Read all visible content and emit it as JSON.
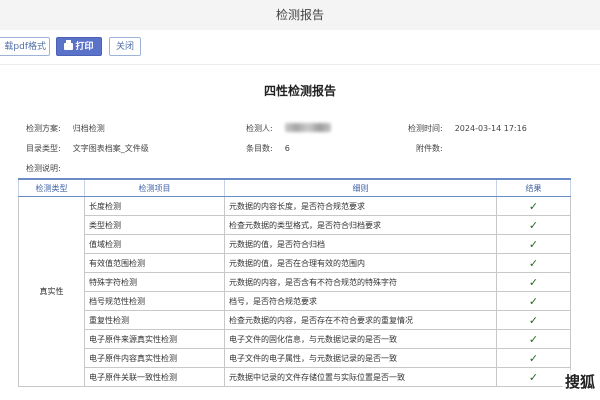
{
  "window": {
    "title": "检测报告"
  },
  "toolbar": {
    "export_label": "载pdf格式",
    "print_label": "打印",
    "close_label": "关闭"
  },
  "report": {
    "title": "四性检测报告",
    "meta": {
      "scheme_label": "检测方案:",
      "scheme_value": "归档检测",
      "inspector_label": "检测人:",
      "time_label": "检测时间:",
      "time_value": "2024-03-14 17:16",
      "catalog_label": "目录类型:",
      "catalog_value": "文字图表档案_文件级",
      "count_label": "条目数:",
      "count_value": "6",
      "attach_label": "附件数:",
      "desc_label": "检测说明:"
    },
    "table": {
      "headers": [
        "检测类型",
        "检测项目",
        "细则",
        "结果"
      ],
      "category": "真实性",
      "rows": [
        {
          "item": "长度检测",
          "rule": "元数据的内容长度，是否符合规范要求",
          "result": "✓"
        },
        {
          "item": "类型检测",
          "rule": "检查元数据的类型格式，是否符合归档要求",
          "result": "✓"
        },
        {
          "item": "值域检测",
          "rule": "元数据的值，是否符合归档",
          "result": "✓"
        },
        {
          "item": "有效值范围检测",
          "rule": "元数据的值，是否在合理有效的范围内",
          "result": "✓"
        },
        {
          "item": "特殊字符检测",
          "rule": "元数据的内容，是否含有不符合规范的特殊字符",
          "result": "✓"
        },
        {
          "item": "档号规范性检测",
          "rule": "档号，是否符合规范要求",
          "result": "✓"
        },
        {
          "item": "重复性检测",
          "rule": "检查元数据的内容，是否存在不符合要求的重复情况",
          "result": "✓"
        },
        {
          "item": "电子原件来源真实性检测",
          "rule": "电子文件的固化信息，与元数据记录的是否一致",
          "result": "✓"
        },
        {
          "item": "电子原件内容真实性检测",
          "rule": "电子文件的电子属性，与元数据记录的是否一致",
          "result": "✓"
        },
        {
          "item": "电子原件关联一致性检测",
          "rule": "元数据中记录的文件存储位置与实际位置是否一致",
          "result": "✓"
        }
      ]
    }
  },
  "watermark": "搜狐"
}
